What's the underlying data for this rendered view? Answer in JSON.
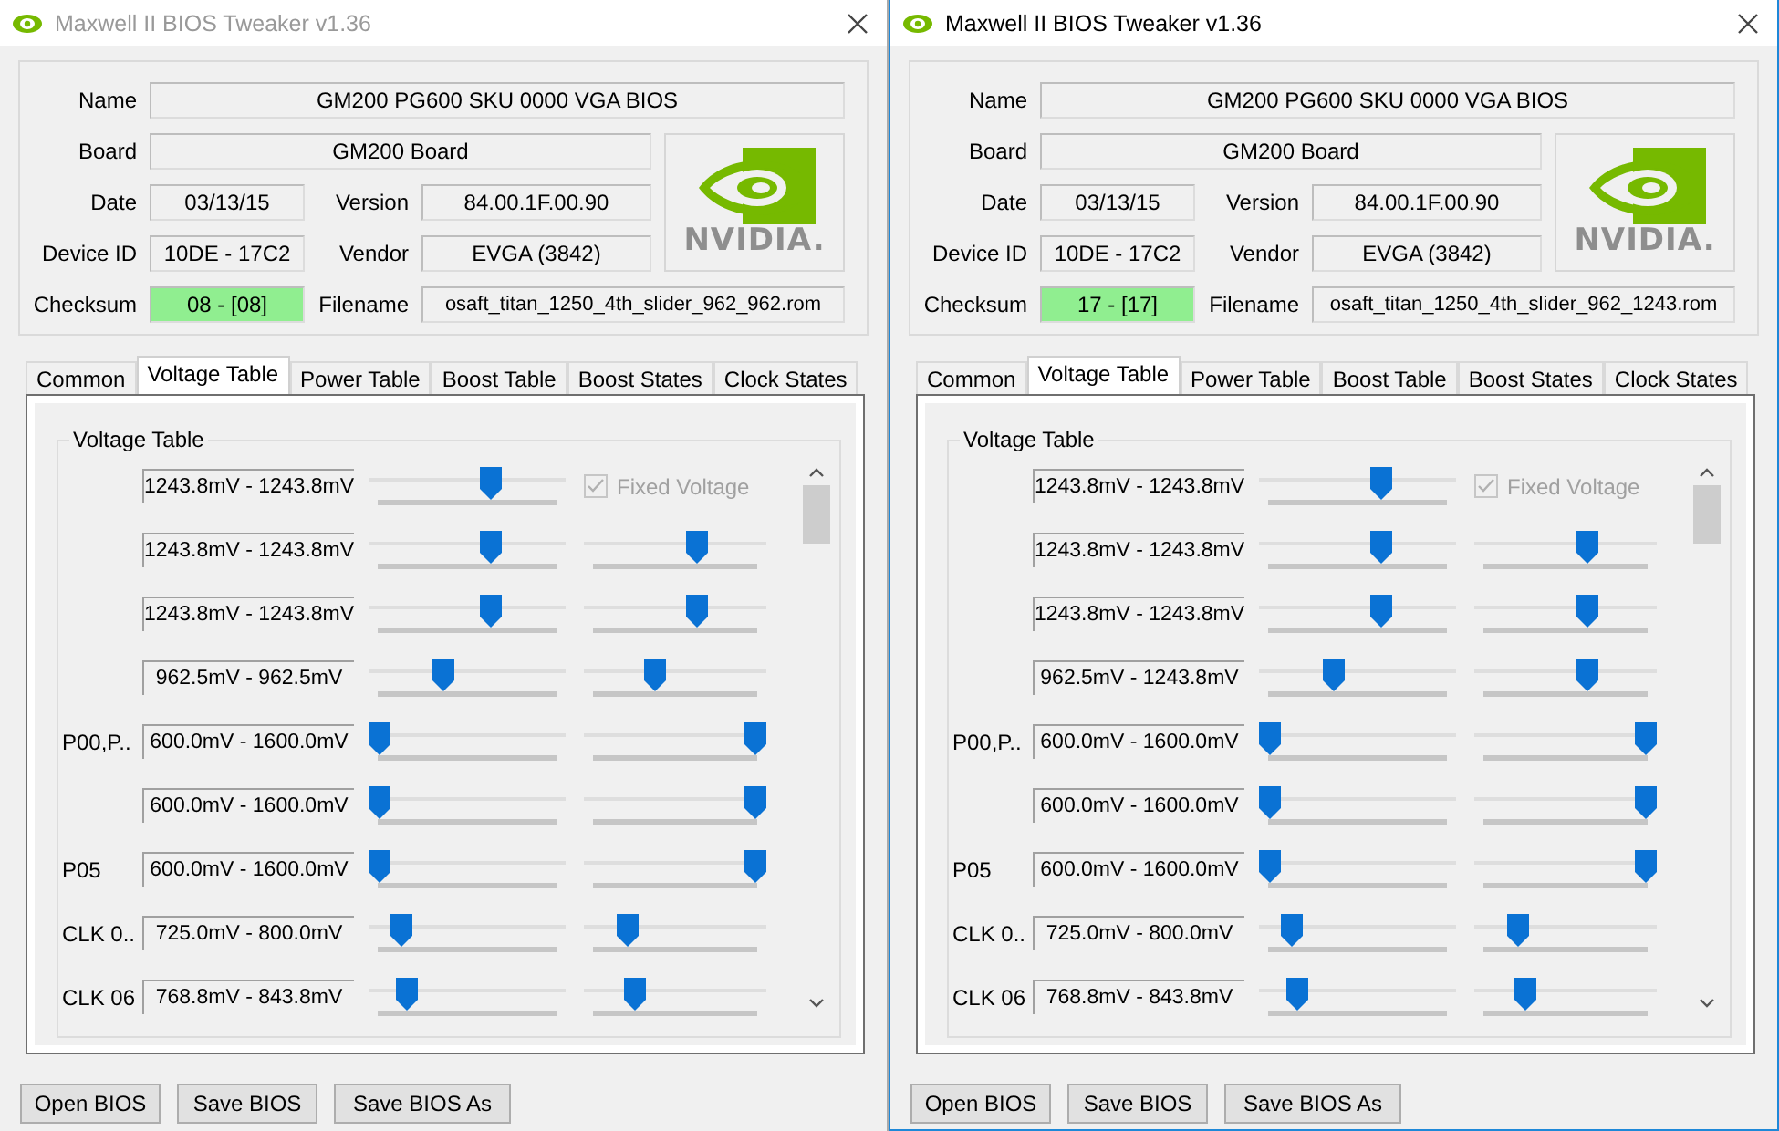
{
  "windows": [
    {
      "title": "Maxwell II BIOS Tweaker v1.36",
      "active": false,
      "info": {
        "name": {
          "label": "Name",
          "value": "GM200 PG600 SKU 0000 VGA BIOS"
        },
        "board": {
          "label": "Board",
          "value": "GM200 Board"
        },
        "date": {
          "label": "Date",
          "value": "03/13/15"
        },
        "version": {
          "label": "Version",
          "value": "84.00.1F.00.90"
        },
        "device_id": {
          "label": "Device ID",
          "value": "10DE - 17C2"
        },
        "vendor": {
          "label": "Vendor",
          "value": "EVGA (3842)"
        },
        "checksum": {
          "label": "Checksum",
          "value": "08 - [08]",
          "ok": true
        },
        "filename": {
          "label": "Filename",
          "value": "osaft_titan_1250_4th_slider_962_962.rom"
        }
      },
      "logo_text": "NVIDIA.",
      "tabs": [
        {
          "label": "Common",
          "selected": false
        },
        {
          "label": "Voltage Table",
          "selected": true
        },
        {
          "label": "Power Table",
          "selected": false
        },
        {
          "label": "Boost Table",
          "selected": false
        },
        {
          "label": "Boost States",
          "selected": false
        },
        {
          "label": "Clock States",
          "selected": false
        }
      ],
      "group_title": "Voltage Table",
      "rows": [
        {
          "range": "1243.8mV - 1243.8mV",
          "sliders": [
            {
              "level": 0.64
            }
          ],
          "fixed_voltage": {
            "label": "Fixed Voltage",
            "checked": true,
            "disabled": true
          }
        },
        {
          "range": "1243.8mV - 1243.8mV",
          "sliders": [
            {
              "level": 0.64
            },
            {
              "level": 0.64
            }
          ]
        },
        {
          "range": "1243.8mV - 1243.8mV",
          "sliders": [
            {
              "level": 0.64
            },
            {
              "level": 0.64
            }
          ]
        },
        {
          "range": "962.5mV - 962.5mV",
          "sliders": [
            {
              "level": 0.36
            },
            {
              "level": 0.37
            }
          ]
        },
        {
          "label": "P00,P..",
          "range": "600.0mV - 1600.0mV",
          "sliders": [
            {
              "level": 0
            },
            {
              "level": 1
            }
          ]
        },
        {
          "range": "600.0mV - 1600.0mV",
          "sliders": [
            {
              "level": 0
            },
            {
              "level": 1
            }
          ]
        },
        {
          "label": "P05",
          "range": "600.0mV - 1600.0mV",
          "sliders": [
            {
              "level": 0
            },
            {
              "level": 1
            }
          ]
        },
        {
          "label": "CLK 0..",
          "range": "725.0mV - 800.0mV",
          "sliders": [
            {
              "level": 0.12
            },
            {
              "level": 0.2
            }
          ]
        },
        {
          "label": "CLK 06",
          "range": "768.8mV - 843.8mV",
          "sliders": [
            {
              "level": 0.16
            },
            {
              "level": 0.25
            }
          ]
        }
      ],
      "buttons": [
        "Open BIOS",
        "Save BIOS",
        "Save BIOS As"
      ]
    },
    {
      "title": "Maxwell II BIOS Tweaker v1.36",
      "active": true,
      "info": {
        "name": {
          "label": "Name",
          "value": "GM200 PG600 SKU 0000 VGA BIOS"
        },
        "board": {
          "label": "Board",
          "value": "GM200 Board"
        },
        "date": {
          "label": "Date",
          "value": "03/13/15"
        },
        "version": {
          "label": "Version",
          "value": "84.00.1F.00.90"
        },
        "device_id": {
          "label": "Device ID",
          "value": "10DE - 17C2"
        },
        "vendor": {
          "label": "Vendor",
          "value": "EVGA (3842)"
        },
        "checksum": {
          "label": "Checksum",
          "value": "17 - [17]",
          "ok": true
        },
        "filename": {
          "label": "Filename",
          "value": "osaft_titan_1250_4th_slider_962_1243.rom"
        }
      },
      "logo_text": "NVIDIA.",
      "tabs": [
        {
          "label": "Common",
          "selected": false
        },
        {
          "label": "Voltage Table",
          "selected": true
        },
        {
          "label": "Power Table",
          "selected": false
        },
        {
          "label": "Boost Table",
          "selected": false
        },
        {
          "label": "Boost States",
          "selected": false
        },
        {
          "label": "Clock States",
          "selected": false
        }
      ],
      "group_title": "Voltage Table",
      "rows": [
        {
          "range": "1243.8mV - 1243.8mV",
          "sliders": [
            {
              "level": 0.64
            }
          ],
          "fixed_voltage": {
            "label": "Fixed Voltage",
            "checked": true,
            "disabled": true
          }
        },
        {
          "range": "1243.8mV - 1243.8mV",
          "sliders": [
            {
              "level": 0.64
            },
            {
              "level": 0.64
            }
          ]
        },
        {
          "range": "1243.8mV - 1243.8mV",
          "sliders": [
            {
              "level": 0.64
            },
            {
              "level": 0.64
            }
          ]
        },
        {
          "range": "962.5mV - 1243.8mV",
          "sliders": [
            {
              "level": 0.36
            },
            {
              "level": 0.64
            }
          ]
        },
        {
          "label": "P00,P..",
          "range": "600.0mV - 1600.0mV",
          "sliders": [
            {
              "level": 0
            },
            {
              "level": 1
            }
          ]
        },
        {
          "range": "600.0mV - 1600.0mV",
          "sliders": [
            {
              "level": 0
            },
            {
              "level": 1
            }
          ]
        },
        {
          "label": "P05",
          "range": "600.0mV - 1600.0mV",
          "sliders": [
            {
              "level": 0
            },
            {
              "level": 1
            }
          ]
        },
        {
          "label": "CLK 0..",
          "range": "725.0mV - 800.0mV",
          "sliders": [
            {
              "level": 0.12
            },
            {
              "level": 0.2
            }
          ]
        },
        {
          "label": "CLK 06",
          "range": "768.8mV - 843.8mV",
          "sliders": [
            {
              "level": 0.16
            },
            {
              "level": 0.25
            }
          ]
        }
      ],
      "buttons": [
        "Open BIOS",
        "Save BIOS",
        "Save BIOS As"
      ]
    }
  ]
}
